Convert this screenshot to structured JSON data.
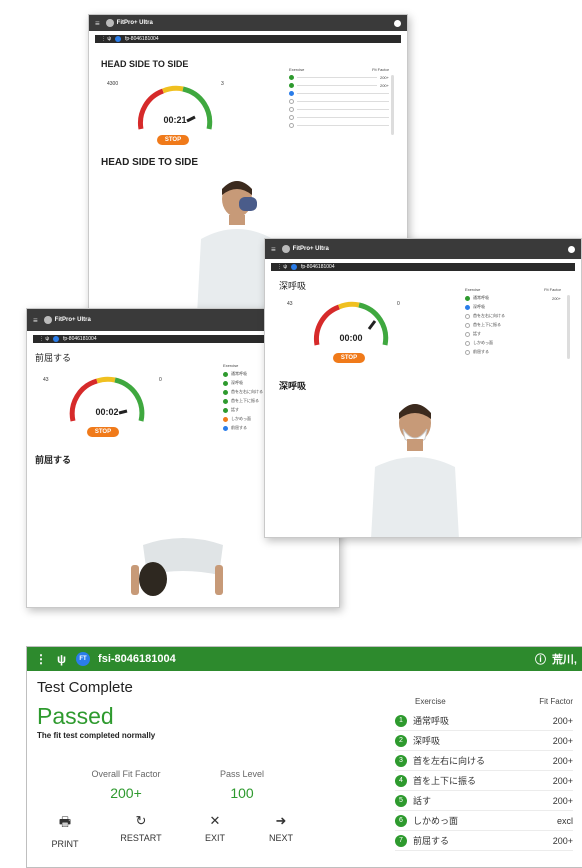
{
  "colors": {
    "accent_green": "#2e9a2e",
    "stop_orange": "#f07a1a",
    "bar_dark": "#3a3a3a",
    "header_green": "#2d8a2d"
  },
  "window1": {
    "app_name": "FitPro+ Ultra",
    "device_id": "fp-8046181004",
    "heading": "HEAD SIDE TO SIDE",
    "caption": "HEAD SIDE TO SIDE",
    "left_value": "4300",
    "right_value": "3",
    "timer": "00:21",
    "stop_label": "STOP",
    "list_header": "Exercise",
    "list_header_ff": "Fit Factor",
    "exercises": [
      {
        "state": "done",
        "ff": "200+"
      },
      {
        "state": "done",
        "ff": "200+"
      },
      {
        "state": "cur",
        "ff": ""
      },
      {
        "state": "todo",
        "ff": ""
      },
      {
        "state": "todo",
        "ff": ""
      },
      {
        "state": "todo",
        "ff": ""
      },
      {
        "state": "todo",
        "ff": ""
      }
    ]
  },
  "window2": {
    "app_name": "FitPro+ Ultra",
    "device_id": "fp-8046181004",
    "heading": "深呼吸",
    "caption": "深呼吸",
    "left_value": "43",
    "right_value": "0",
    "timer": "00:00",
    "stop_label": "STOP",
    "list_header": "Exercise",
    "list_header_ff": "Fit Factor",
    "exercises": [
      {
        "state": "done",
        "name": "通常呼吸",
        "ff": "200+"
      },
      {
        "state": "cur",
        "name": "深呼吸",
        "ff": ""
      },
      {
        "state": "todo",
        "name": "首を左右に向ける",
        "ff": ""
      },
      {
        "state": "todo",
        "name": "首を上下に振る",
        "ff": ""
      },
      {
        "state": "todo",
        "name": "話す",
        "ff": ""
      },
      {
        "state": "todo",
        "name": "しかめっ面",
        "ff": ""
      },
      {
        "state": "todo",
        "name": "前屈する",
        "ff": ""
      }
    ]
  },
  "window3": {
    "app_name": "FitPro+ Ultra",
    "device_id": "fp-8046181004",
    "heading": "前屈する",
    "caption": "前屈する",
    "left_value": "43",
    "right_value": "0",
    "timer": "00:02",
    "stop_label": "STOP",
    "list_header": "Exercise",
    "exercises": [
      {
        "state": "done",
        "name": "通常呼吸"
      },
      {
        "state": "done",
        "name": "深呼吸"
      },
      {
        "state": "done",
        "name": "首を左右に向ける"
      },
      {
        "state": "done",
        "name": "首を上下に振る"
      },
      {
        "state": "done",
        "name": "話す"
      },
      {
        "state": "warn",
        "name": "しかめっ面"
      },
      {
        "state": "cur",
        "name": "前屈する"
      }
    ]
  },
  "result": {
    "device_id": "fsi-8046181004",
    "ft_badge": "FT",
    "user": "荒川,",
    "title": "Test Complete",
    "status": "Passed",
    "status_sub": "The fit test completed normally",
    "overall_label": "Overall Fit Factor",
    "overall_value": "200+",
    "pass_label": "Pass Level",
    "pass_value": "100",
    "actions": {
      "print": "PRINT",
      "restart": "RESTART",
      "exit": "EXIT",
      "next": "NEXT"
    },
    "table_headers": {
      "exercise": "Exercise",
      "fit_factor": "Fit Factor"
    },
    "rows": [
      {
        "num": "1",
        "name": "通常呼吸",
        "ff": "200+"
      },
      {
        "num": "2",
        "name": "深呼吸",
        "ff": "200+"
      },
      {
        "num": "3",
        "name": "首を左右に向ける",
        "ff": "200+"
      },
      {
        "num": "4",
        "name": "首を上下に振る",
        "ff": "200+"
      },
      {
        "num": "5",
        "name": "話す",
        "ff": "200+"
      },
      {
        "num": "6",
        "name": "しかめっ面",
        "ff": "excl"
      },
      {
        "num": "7",
        "name": "前屈する",
        "ff": "200+"
      }
    ]
  }
}
